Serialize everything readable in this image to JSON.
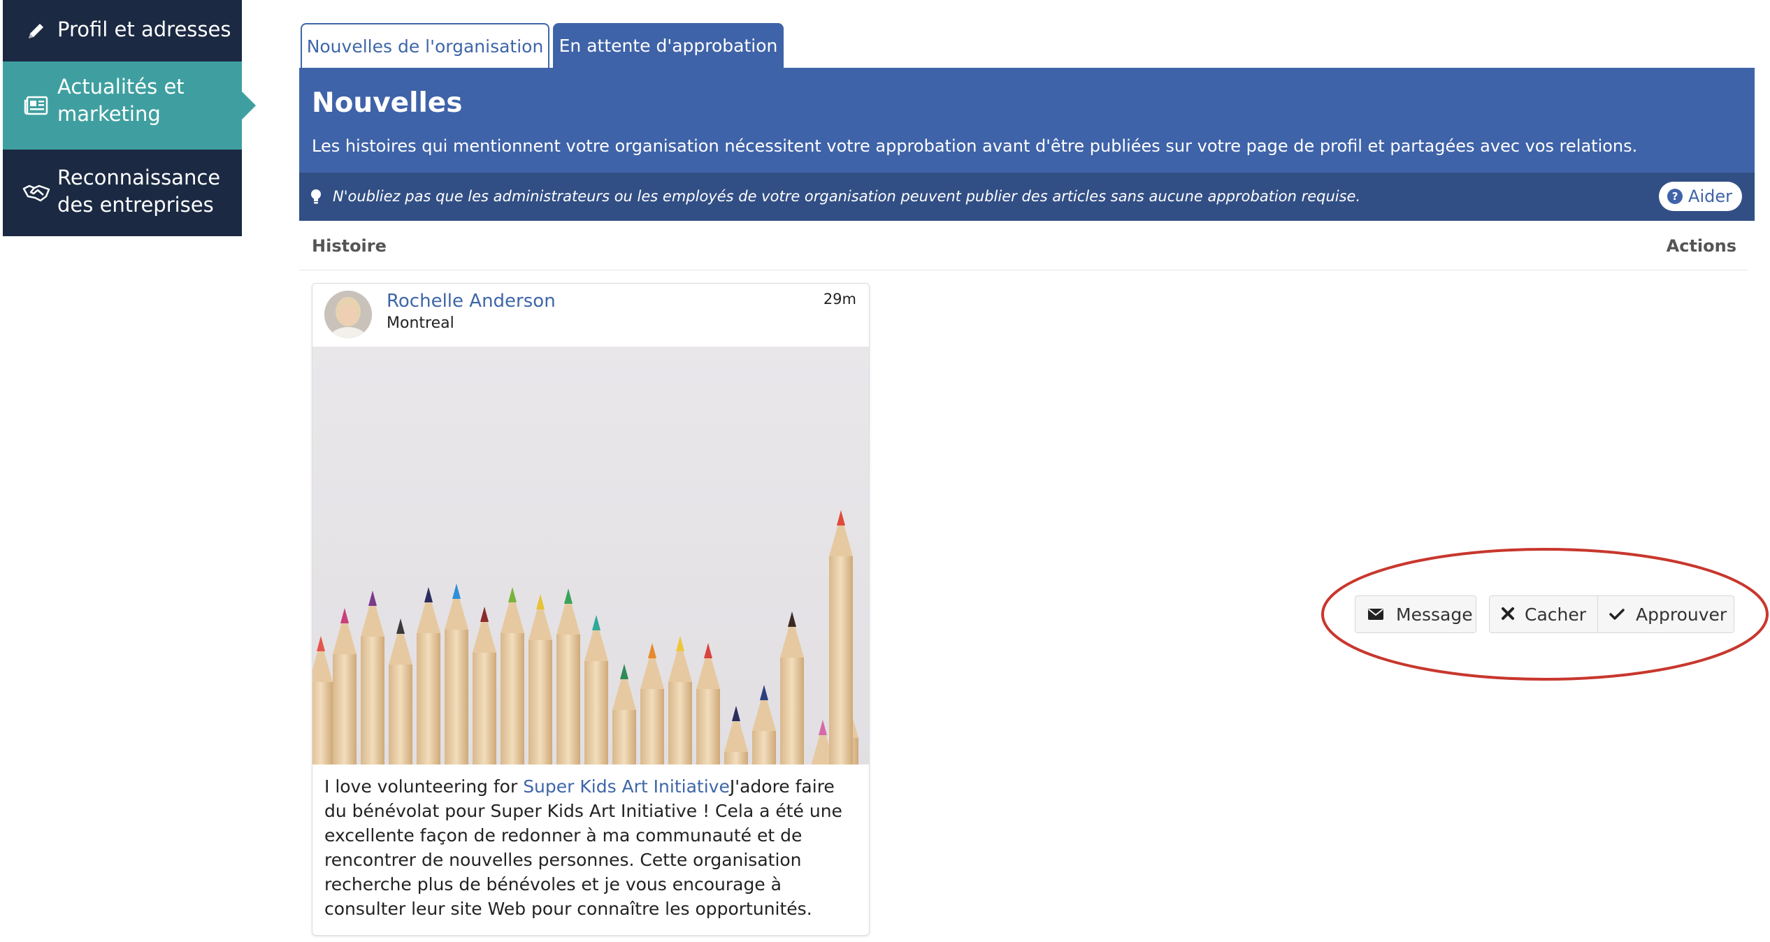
{
  "sidebar": {
    "items": [
      {
        "label_line1": "Profil et adresses",
        "label_line2": "",
        "icon": "pencil-icon"
      },
      {
        "label_line1": "Actualités et",
        "label_line2": "marketing",
        "icon": "newspaper-icon",
        "active": true
      },
      {
        "label_line1": "Reconnaissance",
        "label_line2": "des entreprises",
        "icon": "handshake-icon"
      }
    ]
  },
  "tabs": {
    "org_news": "Nouvelles de l'organisation",
    "pending": "En attente d'approbation"
  },
  "panel": {
    "title": "Nouvelles",
    "description": "Les histoires qui mentionnent votre organisation nécessitent votre approbation avant d'être publiées sur votre page de profil et partagées avec vos relations.",
    "note": "N'oubliez pas que les administrateurs ou les employés de votre organisation peuvent publier des articles sans aucune approbation requise.",
    "help_label": "Aider"
  },
  "table": {
    "col_story": "Histoire",
    "col_actions": "Actions"
  },
  "post": {
    "author": "Rochelle Anderson",
    "location": "Montreal",
    "time": "29m",
    "text_before": "I love volunteering for ",
    "link": "Super Kids Art Initiative",
    "text_after": "J'adore faire du bénévolat pour Super Kids Art Initiative ! Cela a été une excellente façon de redonner à ma communauté et de rencontrer de nouvelles personnes. Cette organisation recherche plus de bénévoles et je vous encourage à consulter leur site Web pour connaître les opportunités."
  },
  "actions": {
    "message": "Message",
    "hide": "Cacher",
    "approve": "Approuver"
  },
  "colors": {
    "sidebar_dark": "#1b2942",
    "sidebar_active": "#3f9fa0",
    "primary_blue": "#3f63a8",
    "note_blue": "#324f85",
    "link_blue": "#3e66a8",
    "annotation_red": "#c8372d"
  }
}
